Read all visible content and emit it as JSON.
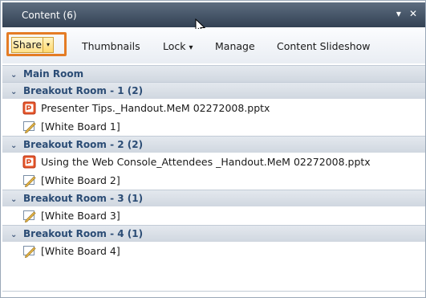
{
  "window": {
    "title": "Content (6)",
    "pin_glyph": "▾",
    "close_glyph": "✕"
  },
  "toolbar": {
    "share_label": "Share",
    "share_dropdown_glyph": "▾",
    "thumbnails_label": "Thumbnails",
    "lock_label": "Lock",
    "lock_dropdown_glyph": "▾",
    "manage_label": "Manage",
    "slideshow_label": "Content Slideshow"
  },
  "accent_color": "#e47c25",
  "groups": [
    {
      "label": "Main Room",
      "items": []
    },
    {
      "label": "Breakout Room - 1 (2)",
      "items": [
        {
          "type": "pptx",
          "icon": "powerpoint-file-icon",
          "label": "Presenter Tips._Handout.MeM 02272008.pptx"
        },
        {
          "type": "whiteboard",
          "icon": "whiteboard-icon",
          "label": "[White Board 1]"
        }
      ]
    },
    {
      "label": "Breakout Room - 2 (2)",
      "items": [
        {
          "type": "pptx",
          "icon": "powerpoint-file-icon",
          "label": "Using the Web Console_Attendees _Handout.MeM 02272008.pptx"
        },
        {
          "type": "whiteboard",
          "icon": "whiteboard-icon",
          "label": "[White Board 2]"
        }
      ]
    },
    {
      "label": "Breakout Room - 3 (1)",
      "items": [
        {
          "type": "whiteboard",
          "icon": "whiteboard-icon",
          "label": "[White Board 3]"
        }
      ]
    },
    {
      "label": "Breakout Room - 4 (1)",
      "items": [
        {
          "type": "whiteboard",
          "icon": "whiteboard-icon",
          "label": "[White Board 4]"
        }
      ]
    }
  ]
}
